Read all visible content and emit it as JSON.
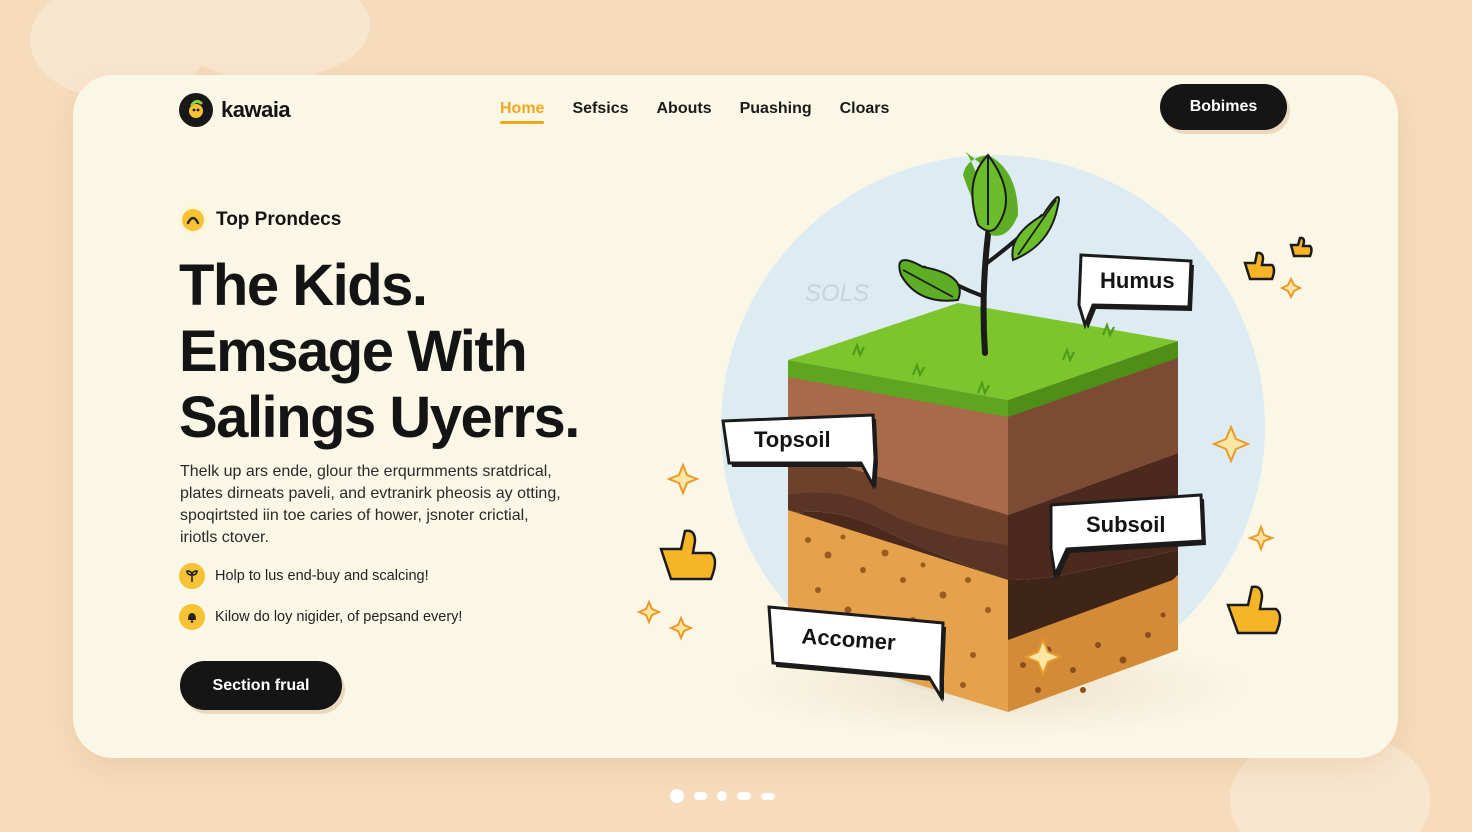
{
  "brand": {
    "name": "kawaia"
  },
  "nav": {
    "items": [
      {
        "label": "Home",
        "active": true
      },
      {
        "label": "Sefsics",
        "active": false
      },
      {
        "label": "Abouts",
        "active": false
      },
      {
        "label": "Puashing",
        "active": false
      },
      {
        "label": "Cloars",
        "active": false
      }
    ],
    "cta_label": "Bobimes"
  },
  "hero": {
    "eyebrow": "Top Prondecs",
    "headline": [
      "The Kids.",
      "Emsage With",
      "Salings Uyerrs."
    ],
    "description": [
      "Thelk up ars ende, glour the erqurmments sratdrical,",
      "plates dirneats paveli, and evtranirk pheosis ay otting,",
      "spoqirtsted iin toe caries of hower, jsnoter crictial,",
      "iriotls ctover."
    ],
    "features": [
      {
        "icon": "sprout-icon",
        "text": "Holp to lus end-buy and scalcing!"
      },
      {
        "icon": "bell-icon",
        "text": "Kilow do loy nigider, of pepsand every!"
      }
    ],
    "cta_label": "Section frual"
  },
  "illustration": {
    "watermark": "SOLS",
    "labels": [
      "Humus",
      "Topsoil",
      "Subsoil",
      "Accomer"
    ]
  },
  "colors": {
    "accent": "#f0a818",
    "dark": "#151515",
    "card": "#fbf7e6",
    "page": "#f6dcbd",
    "grass": "#7cc52c",
    "topsoil": "#a86a48",
    "subsoil": "#5a3424",
    "bedrock": "#e5a24a",
    "circle": "#dcecf2"
  },
  "pagination": {
    "count": 5,
    "active_index": 0
  }
}
